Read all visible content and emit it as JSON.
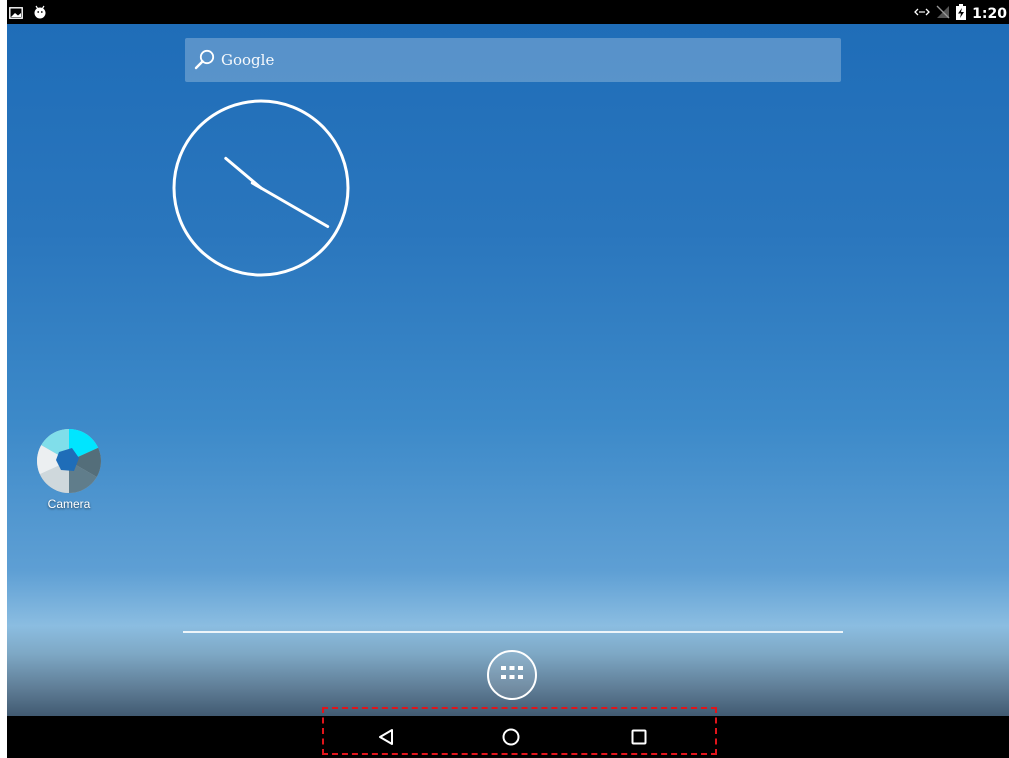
{
  "status_bar": {
    "left_icons": [
      "screenshot-notification-icon",
      "android-debug-icon"
    ],
    "right_icons": [
      "data-sync-icon",
      "no-signal-icon",
      "battery-charging-icon"
    ],
    "time": "1:20"
  },
  "search": {
    "brand": "Google",
    "icon": "search-icon"
  },
  "clock": {
    "hour": 10,
    "minute": 20,
    "widget": "analog-clock"
  },
  "apps": [
    {
      "label": "Camera",
      "icon": "camera-icon"
    }
  ],
  "hotseat": {
    "all_apps_icon": "app-drawer-icon"
  },
  "nav": {
    "back_icon": "back-triangle-icon",
    "home_icon": "home-circle-icon",
    "recents_icon": "recents-square-icon"
  },
  "colors": {
    "highlight": "#e0151b",
    "wallpaper_top": "#1f6db8"
  }
}
